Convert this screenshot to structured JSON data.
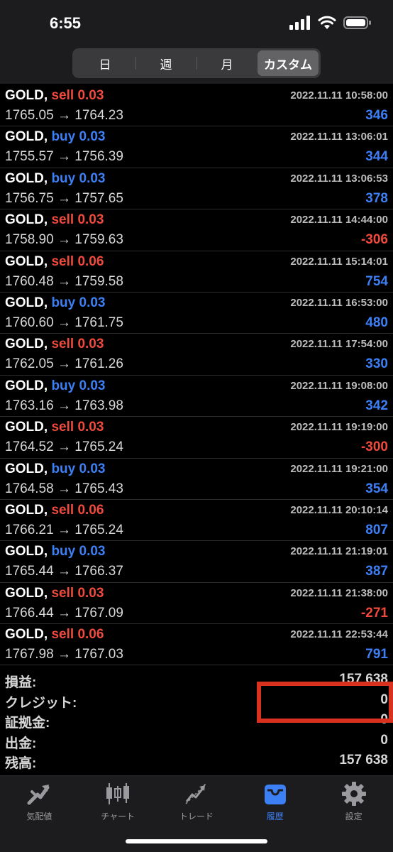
{
  "status_bar": {
    "time": "6:55"
  },
  "period_tabs": [
    {
      "label": "日",
      "active": false
    },
    {
      "label": "週",
      "active": false
    },
    {
      "label": "月",
      "active": false
    },
    {
      "label": "カスタム",
      "active": true
    }
  ],
  "deals": [
    {
      "symbol": "GOLD,",
      "side": "sell",
      "volume": "0.03",
      "open": "1765.05",
      "close": "1764.23",
      "time": "2022.11.11 10:58:00",
      "profit": "346"
    },
    {
      "symbol": "GOLD,",
      "side": "buy",
      "volume": "0.03",
      "open": "1755.57",
      "close": "1756.39",
      "time": "2022.11.11 13:06:01",
      "profit": "344"
    },
    {
      "symbol": "GOLD,",
      "side": "buy",
      "volume": "0.03",
      "open": "1756.75",
      "close": "1757.65",
      "time": "2022.11.11 13:06:53",
      "profit": "378"
    },
    {
      "symbol": "GOLD,",
      "side": "sell",
      "volume": "0.03",
      "open": "1758.90",
      "close": "1759.63",
      "time": "2022.11.11 14:44:00",
      "profit": "-306"
    },
    {
      "symbol": "GOLD,",
      "side": "sell",
      "volume": "0.06",
      "open": "1760.48",
      "close": "1759.58",
      "time": "2022.11.11 15:14:01",
      "profit": "754"
    },
    {
      "symbol": "GOLD,",
      "side": "buy",
      "volume": "0.03",
      "open": "1760.60",
      "close": "1761.75",
      "time": "2022.11.11 16:53:00",
      "profit": "480"
    },
    {
      "symbol": "GOLD,",
      "side": "sell",
      "volume": "0.03",
      "open": "1762.05",
      "close": "1761.26",
      "time": "2022.11.11 17:54:00",
      "profit": "330"
    },
    {
      "symbol": "GOLD,",
      "side": "buy",
      "volume": "0.03",
      "open": "1763.16",
      "close": "1763.98",
      "time": "2022.11.11 19:08:00",
      "profit": "342"
    },
    {
      "symbol": "GOLD,",
      "side": "sell",
      "volume": "0.03",
      "open": "1764.52",
      "close": "1765.24",
      "time": "2022.11.11 19:19:00",
      "profit": "-300"
    },
    {
      "symbol": "GOLD,",
      "side": "buy",
      "volume": "0.03",
      "open": "1764.58",
      "close": "1765.43",
      "time": "2022.11.11 19:21:00",
      "profit": "354"
    },
    {
      "symbol": "GOLD,",
      "side": "sell",
      "volume": "0.06",
      "open": "1766.21",
      "close": "1765.24",
      "time": "2022.11.11 20:10:14",
      "profit": "807"
    },
    {
      "symbol": "GOLD,",
      "side": "buy",
      "volume": "0.03",
      "open": "1765.44",
      "close": "1766.37",
      "time": "2022.11.11 21:19:01",
      "profit": "387"
    },
    {
      "symbol": "GOLD,",
      "side": "sell",
      "volume": "0.03",
      "open": "1766.44",
      "close": "1767.09",
      "time": "2022.11.11 21:38:00",
      "profit": "-271"
    },
    {
      "symbol": "GOLD,",
      "side": "sell",
      "volume": "0.06",
      "open": "1767.98",
      "close": "1767.03",
      "time": "2022.11.11 22:53:44",
      "profit": "791"
    }
  ],
  "arrow": "→",
  "summary": {
    "profit_label": "損益:",
    "profit_value": "157 638",
    "credit_label": "クレジット:",
    "credit_value": "0",
    "deposit_label": "証拠金:",
    "deposit_value": "0",
    "withdrawal_label": "出金:",
    "withdrawal_value": "0",
    "balance_label": "残高:",
    "balance_value": "157 638"
  },
  "tab_bar": [
    {
      "label": "気配値",
      "icon": "quotes-arrows-icon",
      "active": false
    },
    {
      "label": "チャート",
      "icon": "candlestick-chart-icon",
      "active": false
    },
    {
      "label": "トレード",
      "icon": "trade-chart-icon",
      "active": false
    },
    {
      "label": "履歴",
      "icon": "history-tray-icon",
      "active": true
    },
    {
      "label": "設定",
      "icon": "gear-icon",
      "active": false
    }
  ],
  "colors": {
    "sell": "#ef4a3c",
    "buy": "#3d7ff5",
    "highlight": "#d9311f",
    "active_tab": "#3d7ff5"
  }
}
